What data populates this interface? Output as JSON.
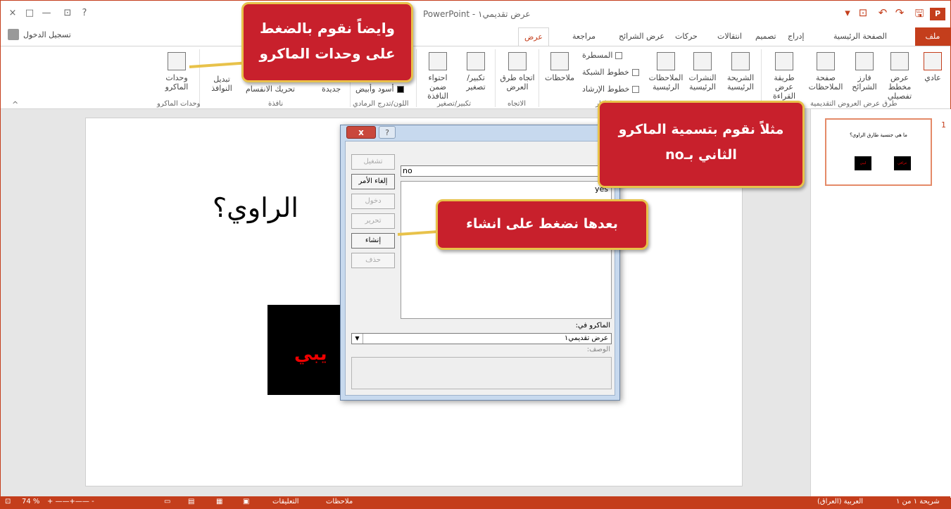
{
  "window": {
    "title": "عرض تقديمي١ - PowerPoint",
    "controls": {
      "close": "×",
      "restore": "□",
      "minimize": "—",
      "ribbon_options": "⊡",
      "help": "?"
    },
    "quick_access": {
      "save": "🖫",
      "redo": "↷",
      "undo": "↶",
      "start_slideshow": "⊡",
      "customize": "▾",
      "app_icon": "P"
    }
  },
  "tabs": {
    "file": "ملف",
    "home": "الصفحة الرئيسية",
    "insert": "إدراج",
    "design": "تصميم",
    "transitions": "انتقالات",
    "animations": "حركات",
    "slideshow": "عرض الشرائح",
    "review": "مراجعة",
    "view": "عرض",
    "signin": "تسجيل الدخول"
  },
  "ribbon": {
    "normal": "عادي",
    "outline": "عرض مخطط تفصيلي",
    "sorter": "فارز الشرائح",
    "notes_page": "صفحة الملاحظات",
    "reading_view": "طريقة عرض القراءة",
    "group_presentation_views": "طرق عرض العروض التقديمية",
    "slide_master": "الشريحة الرئيسية",
    "handout_master": "النشرات الرئيسية",
    "notes_master": "الملاحظات الرئيسية",
    "ruler": "المسطرة",
    "gridlines": "خطوط الشبكة",
    "guides": "خطوط الإرشاد",
    "notes": "ملاحظات",
    "group_show": "إظهار",
    "direction": "اتجاه طرق العرض",
    "group_direction": "الاتجاه",
    "zoom": "تكبير/ تصغير",
    "fit_window": "احتواء ضمن النافذة",
    "group_zoom": "تكبير/تصغير",
    "bw": "أسود وأبيض",
    "group_color": "اللون/تدرج الرمادي",
    "new_window": "جديدة",
    "move_split": "تحريك الانقسام",
    "switch_windows": "تبديل النوافذ",
    "group_window": "نافذة",
    "macros": "وحدات الماكرو",
    "group_macros": "وحدات الماكرو",
    "collapse": "^"
  },
  "slide": {
    "title": "الراوي؟",
    "red_text": "يبي"
  },
  "thumbnail": {
    "number": "1",
    "question": "ما هي جنسية طارق الراوي؟",
    "label_left": "ليبي",
    "label_right": "عراقي"
  },
  "status": {
    "slide_of": "شريحة ١ من ١",
    "language": "العربية (العراق)",
    "notes": "ملاحظات",
    "comments": "التعليقات",
    "zoom": "74 %"
  },
  "dialog": {
    "close": "x",
    "help": "?",
    "run": "تشغيل",
    "cancel": "إلغاء الأمر",
    "step_into": "دخول",
    "edit": "تحرير",
    "create": "إنشاء",
    "delete": "حذف",
    "name_value": "no",
    "list_items": [
      "yes"
    ],
    "macro_in_label": "الماكرو في:",
    "macro_in_value": "عرض تقديمي١",
    "description_label": "الوصف:"
  },
  "callouts": {
    "c1_line1": "وايضاً نقوم بالضغط",
    "c1_line2": "على وحدات الماكرو",
    "c2_line1": "مثلاً نقوم بتسمية الماكرو",
    "c2_line2": "الثاني بـno",
    "c3": "بعدها نضغط على انشاء"
  },
  "colors": {
    "accent": "#c43e1c",
    "callout_fill": "#c8202c",
    "callout_border": "#e8c24a"
  }
}
